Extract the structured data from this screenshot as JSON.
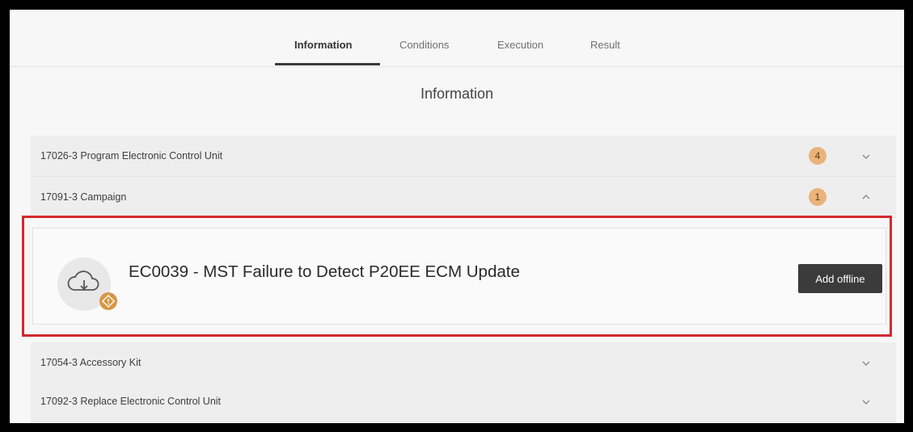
{
  "tabs": {
    "information": "Information",
    "conditions": "Conditions",
    "execution": "Execution",
    "result": "Result"
  },
  "section_title": "Information",
  "rows": [
    {
      "label": "17026-3 Program Electronic Control Unit",
      "count": "4",
      "expanded": false
    },
    {
      "label": "17091-3 Campaign",
      "count": "1",
      "expanded": true
    },
    {
      "label": "17054-3 Accessory Kit",
      "expanded": false
    },
    {
      "label": "17092-3 Replace Electronic Control Unit",
      "expanded": false
    }
  ],
  "campaign_card": {
    "title": "EC0039 - MST Failure to Detect P20EE ECM Update",
    "action_label": "Add offline",
    "icon": "cloud-download-icon",
    "badge_icon": "warning-icon"
  },
  "colors": {
    "badge": "#e9b37b",
    "highlight": "#d4292d",
    "button": "#3b3b3b"
  }
}
